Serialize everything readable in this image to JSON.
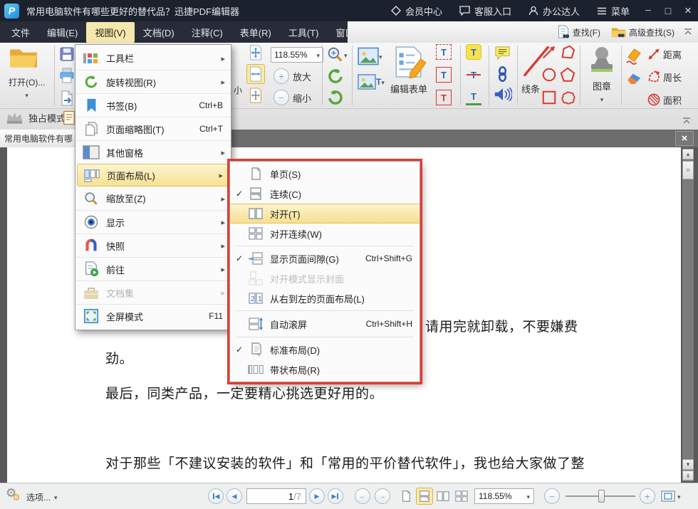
{
  "titlebar": {
    "title": "常用电脑软件有哪些更好的替代品？迅捷PDF编辑器",
    "logo_letter": "P",
    "member_center": "会员中心",
    "customer_service": "客服入口",
    "office_expert": "办公达人",
    "menu": "菜单"
  },
  "menubar": {
    "items": [
      {
        "label": "文件"
      },
      {
        "label": "编辑(E)"
      },
      {
        "label": "视图(V)",
        "active": true
      },
      {
        "label": "文档(D)"
      },
      {
        "label": "注释(C)"
      },
      {
        "label": "表单(R)"
      },
      {
        "label": "工具(T)"
      },
      {
        "label": "窗口(W)"
      }
    ],
    "find": "查找(F)",
    "advanced_find": "高级查找(S)"
  },
  "toolbar": {
    "open_label": "打开(O)...",
    "exclusive_mode": "独占模式",
    "partial_label": "小",
    "zoom_value": "118.55%",
    "zoom_in_label": "放大",
    "zoom_out_label": "缩小",
    "edit_form_label": "编辑表单",
    "line_label": "线条",
    "stamp_label": "图章",
    "distance_label": "距离",
    "perimeter_label": "周长",
    "area_label": "面积"
  },
  "tabbar": {
    "tab_label": "常用电脑软件有哪"
  },
  "view_menu": {
    "items": [
      {
        "label": "工具栏",
        "submenu": true
      },
      {
        "label": "旋转视图(R)",
        "submenu": true
      },
      {
        "label": "书签(B)",
        "shortcut": "Ctrl+B"
      },
      {
        "label": "页面缩略图(T)",
        "shortcut": "Ctrl+T"
      },
      {
        "label": "其他窗格",
        "submenu": true
      },
      {
        "label": "页面布局(L)",
        "submenu": true,
        "highlighted": true
      },
      {
        "label": "缩放至(Z)",
        "submenu": true
      },
      {
        "label": "显示",
        "submenu": true
      },
      {
        "label": "快照",
        "submenu": true
      },
      {
        "label": "前往",
        "submenu": true
      },
      {
        "label": "文档集",
        "submenu": true,
        "disabled": true
      },
      {
        "label": "全屏模式",
        "shortcut": "F11"
      }
    ]
  },
  "layout_submenu": {
    "items": [
      {
        "label": "单页(S)"
      },
      {
        "label": "连续(C)",
        "checked": true
      },
      {
        "label": "对开(T)",
        "highlighted": true
      },
      {
        "label": "对开连续(W)"
      },
      {
        "label": "显示页面间隙(G)",
        "shortcut": "Ctrl+Shift+G",
        "checked": true
      },
      {
        "label": "对开模式显示封面",
        "disabled": true
      },
      {
        "label": "从右到左的页面布局(L)"
      },
      {
        "label": "自动滚屏",
        "shortcut": "Ctrl+Shift+H"
      },
      {
        "label": "标准布局(D)",
        "checked": true
      },
      {
        "label": "带状布局(R)"
      }
    ]
  },
  "document": {
    "line1": "请用完就卸载，不要嫌费",
    "line2": "劲。",
    "line3": "最后，同类产品，一定要精心挑选更好用的。",
    "line4": "对于那些「不建议安装的软件」和「常用的平价替代软件」，我也给大家做了整"
  },
  "statusbar": {
    "options_label": "选项...",
    "page_current": "1",
    "page_total": "/7",
    "zoom_value": "118.55%"
  },
  "colors": {
    "titlebar_bg": "#1c212e",
    "menubar_bg": "#272c38",
    "active_menu_highlight": "#f6e8ac",
    "menu_item_highlight": "#f7e193",
    "annotation_red": "#e8392d",
    "accent_blue": "#3f85c6"
  }
}
